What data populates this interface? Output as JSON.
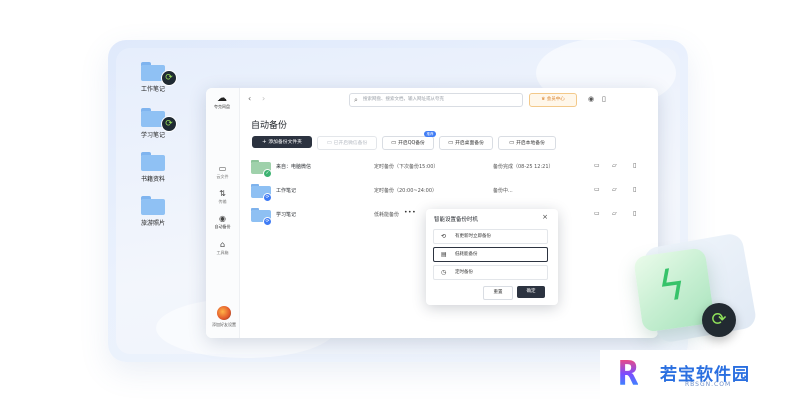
{
  "desktop": {
    "folders": [
      {
        "label": "工作笔记",
        "synced": true
      },
      {
        "label": "学习笔记",
        "synced": true
      },
      {
        "label": "书籍资料",
        "synced": false
      },
      {
        "label": "旅游照片",
        "synced": false
      }
    ]
  },
  "app": {
    "logo_text": "夸克网盘",
    "search_placeholder": "搜索网盘、搜索文档，输入网址或从夸克",
    "vip_label": "会员中心",
    "sidebar": [
      {
        "label": "云文件",
        "icon": "folder-icon"
      },
      {
        "label": "传输",
        "icon": "transfer-icon"
      },
      {
        "label": "自动备份",
        "icon": "backup-icon",
        "active": true
      },
      {
        "label": "工具箱",
        "icon": "toolbox-icon"
      }
    ],
    "avatar_label": "添加好友设置",
    "page_title": "自动备份",
    "toolbar": {
      "add_folder": "添加备份文件夹",
      "wechat_backup": "已开启微信备份",
      "qq_backup": "开启QQ备份",
      "qq_badge": "推荐",
      "desktop_backup": "开启桌面备份",
      "local_backup": "开启本地备份"
    },
    "rows": [
      {
        "name": "来自：电脑微信",
        "mode": "定时备份（下次备份15:00）",
        "status": "备份完成（08-25 12:21）",
        "folder": "green",
        "badge": "done"
      },
      {
        "name": "工作笔记",
        "mode": "定时备份（20:00~24:00）",
        "status": "备份中...",
        "folder": "blue",
        "badge": "sync"
      },
      {
        "name": "学习笔记",
        "mode": "低耗能备份",
        "status": "",
        "folder": "blue",
        "badge": "sync"
      }
    ],
    "popup": {
      "title": "智能设置备份时机",
      "options": [
        "有更新时立即备份",
        "低耗能备份",
        "定时备份"
      ],
      "selected_index": 1,
      "reset": "重置",
      "confirm": "确定"
    }
  },
  "watermark": {
    "name": "若宝软件园",
    "url": "RBSGN.COM"
  }
}
